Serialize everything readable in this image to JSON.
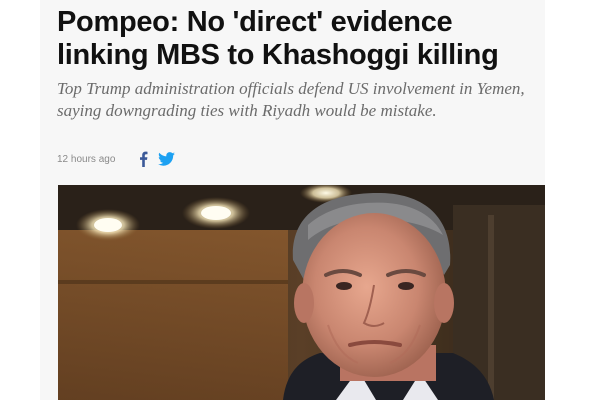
{
  "article": {
    "headline": "Pompeo: No 'direct' evidence linking MBS to Khashoggi killing",
    "standfirst": "Top Trump administration officials defend US involvement in Yemen, saying downgrading ties with Riyadh would be mistake.",
    "timestamp": "12 hours ago",
    "share_icons": [
      "facebook-icon",
      "twitter-icon"
    ]
  },
  "colors": {
    "headline": "#111111",
    "standfirst": "#6b6b6b",
    "timestamp": "#8a8a8a",
    "facebook": "#3b5998",
    "twitter": "#1da1f2"
  }
}
